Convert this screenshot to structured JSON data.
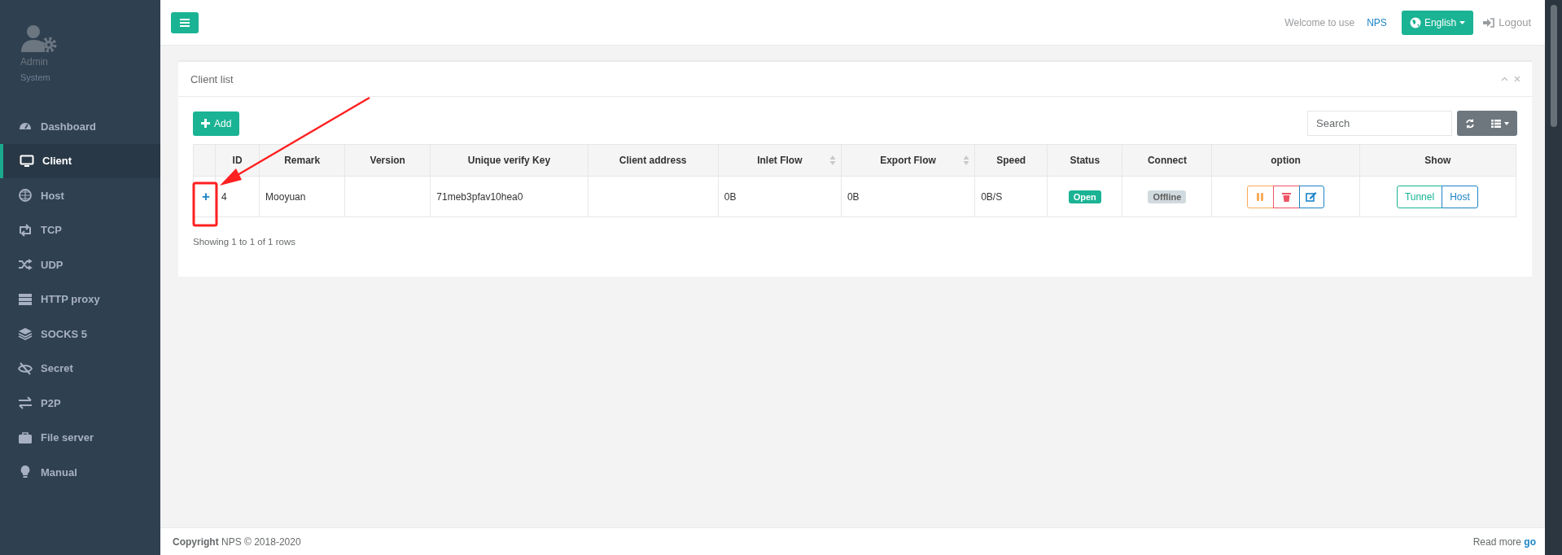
{
  "sidebar": {
    "user_title": "Admin",
    "user_subtitle": "System",
    "items": [
      {
        "label": "Dashboard",
        "kind": "gauge",
        "selected": false
      },
      {
        "label": "Client",
        "kind": "monitor",
        "selected": true
      },
      {
        "label": "Host",
        "kind": "globe",
        "selected": false
      },
      {
        "label": "TCP",
        "kind": "retweet",
        "selected": false
      },
      {
        "label": "UDP",
        "kind": "shuffle",
        "selected": false
      },
      {
        "label": "HTTP proxy",
        "kind": "server",
        "selected": false
      },
      {
        "label": "SOCKS 5",
        "kind": "layers",
        "selected": false
      },
      {
        "label": "Secret",
        "kind": "eye-slash",
        "selected": false
      },
      {
        "label": "P2P",
        "kind": "exchange",
        "selected": false
      },
      {
        "label": "File server",
        "kind": "briefcase",
        "selected": false
      },
      {
        "label": "Manual",
        "kind": "bulb",
        "selected": false
      }
    ]
  },
  "topbar": {
    "welcome": "Welcome to use",
    "brand": "NPS",
    "language": "English",
    "logout": "Logout"
  },
  "card": {
    "title": "Client list",
    "add_label": "Add",
    "search": {
      "placeholder": "Search"
    },
    "table": {
      "columns": [
        {
          "label": "ID",
          "sortable": false
        },
        {
          "label": "Remark",
          "sortable": false
        },
        {
          "label": "Version",
          "sortable": false
        },
        {
          "label": "Unique verify Key",
          "sortable": false
        },
        {
          "label": "Client address",
          "sortable": false
        },
        {
          "label": "Inlet Flow",
          "sortable": true
        },
        {
          "label": "Export Flow",
          "sortable": true
        },
        {
          "label": "Speed",
          "sortable": false
        },
        {
          "label": "Status",
          "sortable": false
        },
        {
          "label": "Connect",
          "sortable": false
        },
        {
          "label": "option",
          "sortable": false
        },
        {
          "label": "Show",
          "sortable": false
        }
      ],
      "rows": [
        {
          "expand": "+",
          "id": "4",
          "remark": "Mooyuan",
          "unique_verify_key": "71meb3pfav10hea0",
          "inlet_flow": "0B",
          "export_flow": "0B",
          "speed": "0B/S",
          "status": {
            "text": "Open",
            "color": "#1ab394"
          },
          "connect": {
            "text": "Offline",
            "color": "#d1dade"
          },
          "show": [
            "Tunnel",
            "Host"
          ]
        }
      ]
    },
    "pagination": "Showing 1 to 1 of 1 rows"
  },
  "footer": {
    "copyright_label": "Copyright",
    "copyright_text": "NPS © 2018-2020",
    "read_more": "Read more",
    "read_more_link": "go"
  }
}
